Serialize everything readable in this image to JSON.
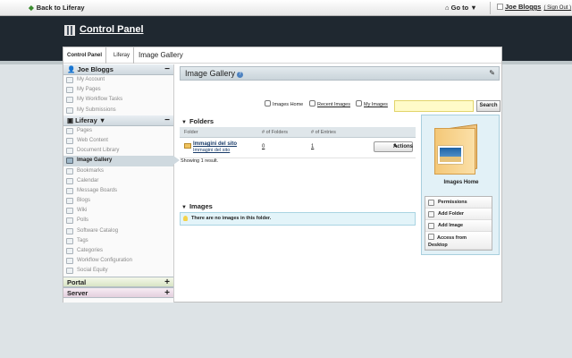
{
  "dockbar": {
    "back_label": "Back to Liferay",
    "goto_label": "Go to ▼",
    "user_name": "Joe Bloggs",
    "sign_out": "( Sign Out )"
  },
  "header": {
    "title": "Control Panel"
  },
  "breadcrumb": [
    "Control Panel",
    "Liferay",
    "Image Gallery"
  ],
  "sidebar": {
    "user_section": {
      "title": "Joe Bloggs",
      "items": [
        "My Account",
        "My Pages",
        "My Workflow Tasks",
        "My Submissions"
      ]
    },
    "liferay_section": {
      "title": "Liferay ▼",
      "items": [
        "Pages",
        "Web Content",
        "Document Library",
        "Image Gallery",
        "Bookmarks",
        "Calendar",
        "Message Boards",
        "Blogs",
        "Wiki",
        "Polls",
        "Software Catalog",
        "Tags",
        "Categories",
        "Workflow Configuration",
        "Social Equity"
      ],
      "active": "Image Gallery"
    },
    "portal_title": "Portal",
    "server_title": "Server"
  },
  "content": {
    "title": "Image Gallery",
    "links": {
      "images_home": "Images Home",
      "recent_images": "Recent Images",
      "my_images": "My Images"
    },
    "search": {
      "value": "",
      "button": "Search"
    },
    "folders_title": "Folders",
    "table": {
      "columns": [
        "Folder",
        "# of Folders",
        "# of Entries"
      ],
      "rows": [
        {
          "name": "Immagini del sito",
          "description": "Immagini del sito",
          "folders": "0",
          "entries": "1",
          "action": "Actions"
        }
      ]
    },
    "showing": "Showing 1 result.",
    "images_title": "Images",
    "empty_message": "There are no images in this folder."
  },
  "right_box": {
    "title": "Images Home",
    "menu": [
      "Permissions",
      "Add Folder",
      "Add Image",
      "Access from",
      "Desktop"
    ]
  }
}
